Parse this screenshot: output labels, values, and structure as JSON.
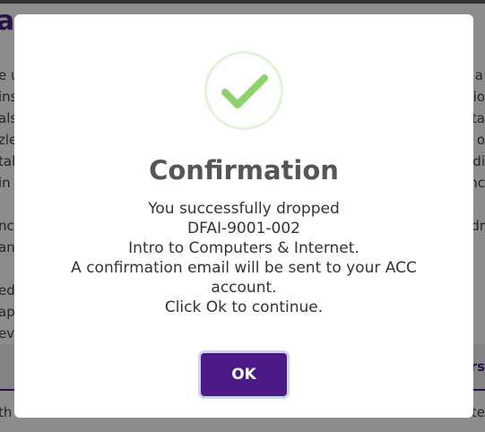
{
  "background": {
    "heading": "a",
    "lines": [
      {
        "left": "e u",
        "right": "a"
      },
      {
        "left": "ins",
        "right": "tio"
      },
      {
        "left": "als",
        "right": "sta"
      },
      {
        "left": "zle",
        "right": "n o"
      },
      {
        "left": "tal",
        "right": "di"
      },
      {
        "left": "in",
        "right": "nc"
      },
      {
        "left": "nc",
        "right": "dr"
      },
      {
        "left": "an",
        "right": ""
      },
      {
        "left": "ed",
        "right": ""
      },
      {
        "left": "ap",
        "right": ""
      },
      {
        "left": "ev",
        "right": ""
      }
    ],
    "band_right": "rs",
    "bottom_left": "th",
    "bottom_right": "te"
  },
  "modal": {
    "title": "Confirmation",
    "icon": "check-icon",
    "message_lines": [
      "You successfully dropped",
      "DFAI-9001-002",
      "Intro to Computers & Internet.",
      "A confirmation email will be sent to your ACC",
      "account.",
      "Click Ok to continue."
    ],
    "ok_label": "OK"
  },
  "colors": {
    "accent": "#4b1a86",
    "check": "#8fd16c"
  }
}
